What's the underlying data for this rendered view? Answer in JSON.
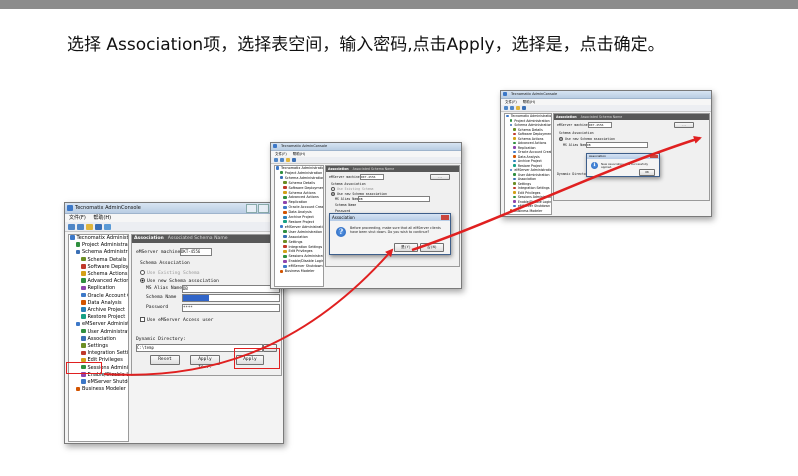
{
  "instruction": "选择 Association项，选择表空间，输入密码,点击Apply，选择是，点击确定。",
  "window_title": "Tecnomatix AdminConsole",
  "menu": {
    "file": "文件(F)",
    "help": "帮助(H)"
  },
  "tree": [
    {
      "label": "Tecnomatix Administration",
      "level": 0
    },
    {
      "label": "Project Administration",
      "level": 1
    },
    {
      "label": "Schema Administration",
      "level": 1
    },
    {
      "label": "Schema Details",
      "level": 2
    },
    {
      "label": "Software Deployment",
      "level": 2
    },
    {
      "label": "Schema Actions",
      "level": 2
    },
    {
      "label": "Advanced Actions",
      "level": 2
    },
    {
      "label": "Replication",
      "level": 2
    },
    {
      "label": "Oracle Account Creation",
      "level": 2
    },
    {
      "label": "Data Analysis",
      "level": 2
    },
    {
      "label": "Archive Project",
      "level": 2
    },
    {
      "label": "Restore Project",
      "level": 2
    },
    {
      "label": "eMServer Administration",
      "level": 1
    },
    {
      "label": "User Administration",
      "level": 2
    },
    {
      "label": "Association",
      "level": 2
    },
    {
      "label": "Settings",
      "level": 2
    },
    {
      "label": "Integration Settings",
      "level": 2
    },
    {
      "label": "Edit Privileges",
      "level": 2
    },
    {
      "label": "Sessions Administration",
      "level": 2
    },
    {
      "label": "Enable/Disable Login",
      "level": 2
    },
    {
      "label": "eMServer Shutdown",
      "level": 2
    },
    {
      "label": "Business Modeler",
      "level": 1
    }
  ],
  "panel": {
    "header": "Association",
    "header_sub": "Associated Schema Name",
    "server_label": "eMServer machine:",
    "server_value": "DKT-4556",
    "group_label": "Schema Association",
    "use_existing": "Use Existing Schema",
    "use_new": "Use new Schema association",
    "ms_alias_label": "MS Alias Name",
    "ms_alias_value": "DB",
    "schema_label": "Schema Name",
    "schema_value": "",
    "password_label": "Password",
    "password_value": "****",
    "access_user": "Use eMServer Access user",
    "dyn_dir_label": "Dynamic Directory:",
    "dyn_dir_value": "C:\\temp",
    "reset": "Reset",
    "apply_to": "Apply to...",
    "apply": "Apply"
  },
  "dialog_confirm": {
    "title": "Association",
    "message": "Before proceeding, make sure that all eMServer clients have been shut down. Do you wish to continue?",
    "yes": "是(Y)",
    "no": "否(N)"
  },
  "dialog_success": {
    "title": "Association",
    "message": "New Association was successfully applied.",
    "ok": "OK"
  },
  "colors": {
    "arrow": "#e02020",
    "header": "#585858"
  }
}
